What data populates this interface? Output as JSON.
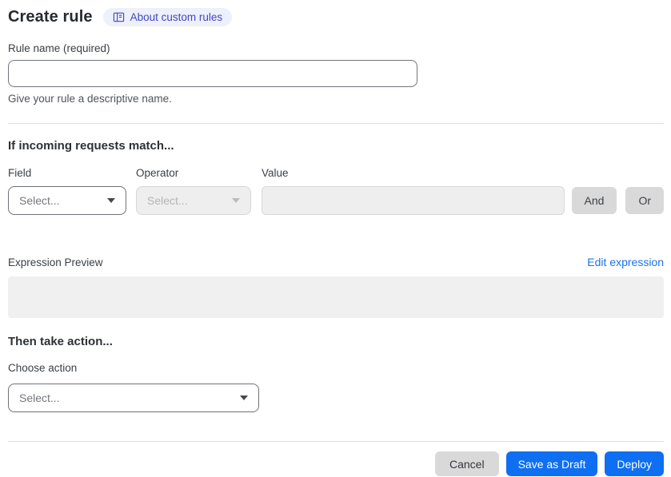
{
  "header": {
    "title": "Create rule",
    "about_label": "About custom rules"
  },
  "rule_name": {
    "label": "Rule name (required)",
    "value": "",
    "helper": "Give your rule a descriptive name."
  },
  "match": {
    "heading": "If incoming requests match...",
    "field": {
      "label": "Field",
      "placeholder": "Select..."
    },
    "operator": {
      "label": "Operator",
      "placeholder": "Select..."
    },
    "value_label": "Value",
    "value": "",
    "and_label": "And",
    "or_label": "Or",
    "expression_preview_label": "Expression Preview",
    "edit_expression_label": "Edit expression",
    "expression_preview_value": ""
  },
  "action": {
    "heading": "Then take action...",
    "choose_label": "Choose action",
    "choose_placeholder": "Select..."
  },
  "footer": {
    "cancel_label": "Cancel",
    "save_draft_label": "Save as Draft",
    "deploy_label": "Deploy"
  },
  "colors": {
    "primary_blue": "#0e6ff2",
    "link_blue": "#1a73e8",
    "badge_bg": "#eef0fb",
    "badge_text": "#3f46c9",
    "disabled_bg": "#eeeeee",
    "gray_button_bg": "#d9d9d9",
    "preview_box_bg": "#f0f0f0"
  }
}
